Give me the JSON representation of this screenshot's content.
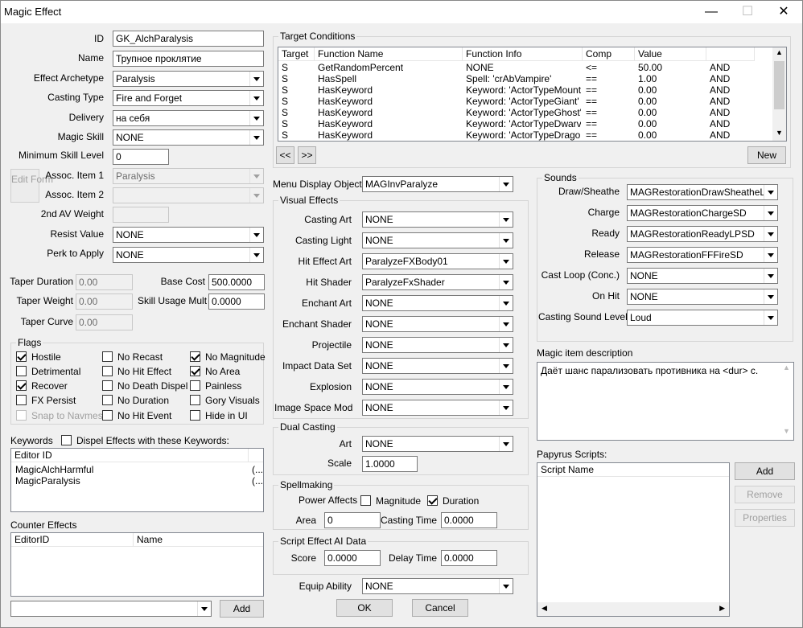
{
  "window": {
    "title": "Magic Effect",
    "minimize": "—",
    "maximize": "☐",
    "close": "✕"
  },
  "left": {
    "id_label": "ID",
    "id_value": "GK_AlchParalysis",
    "name_label": "Name",
    "name_value": "Трупное проклятие",
    "archetype_label": "Effect Archetype",
    "archetype_value": "Paralysis",
    "casting_type_label": "Casting Type",
    "casting_type_value": "Fire and Forget",
    "delivery_label": "Delivery",
    "delivery_value": "на себя",
    "magic_skill_label": "Magic Skill",
    "magic_skill_value": "NONE",
    "min_skill_label": "Minimum Skill Level",
    "min_skill_value": "0",
    "edit_form_label": "Edit Form",
    "assoc1_label": "Assoc. Item 1",
    "assoc1_value": "Paralysis",
    "assoc2_label": "Assoc. Item 2",
    "assoc2_value": "",
    "av2_label": "2nd AV Weight",
    "av2_value": "",
    "resist_label": "Resist Value",
    "resist_value": "NONE",
    "perk_label": "Perk to Apply",
    "perk_value": "NONE",
    "taper_duration_label": "Taper Duration",
    "taper_duration_value": "0.00",
    "taper_weight_label": "Taper Weight",
    "taper_weight_value": "0.00",
    "taper_curve_label": "Taper Curve",
    "taper_curve_value": "0.00",
    "base_cost_label": "Base Cost",
    "base_cost_value": "500.0000",
    "skill_mult_label": "Skill Usage Mult",
    "skill_mult_value": "0.0000"
  },
  "flags": {
    "title": "Flags",
    "items": [
      {
        "label": "Hostile",
        "checked": true,
        "disabled": false
      },
      {
        "label": "No Recast",
        "checked": false,
        "disabled": false
      },
      {
        "label": "No Magnitude",
        "checked": true,
        "disabled": false
      },
      {
        "label": "Detrimental",
        "checked": false,
        "disabled": false
      },
      {
        "label": "No Hit Effect",
        "checked": false,
        "disabled": false
      },
      {
        "label": "No Area",
        "checked": true,
        "disabled": false
      },
      {
        "label": "Recover",
        "checked": true,
        "disabled": false
      },
      {
        "label": "No Death Dispel",
        "checked": false,
        "disabled": false
      },
      {
        "label": "Painless",
        "checked": false,
        "disabled": false
      },
      {
        "label": "FX Persist",
        "checked": false,
        "disabled": false
      },
      {
        "label": "No Duration",
        "checked": false,
        "disabled": false
      },
      {
        "label": "Gory Visuals",
        "checked": false,
        "disabled": false
      },
      {
        "label": "Snap to Navmesh",
        "checked": false,
        "disabled": true
      },
      {
        "label": "No Hit Event",
        "checked": false,
        "disabled": false
      },
      {
        "label": "Hide in UI",
        "checked": false,
        "disabled": false
      }
    ]
  },
  "keywords": {
    "title": "Keywords",
    "dispel_label": "Dispel Effects with these Keywords:",
    "header_id": "Editor ID",
    "rows": [
      {
        "id": "MagicAlchHarmful",
        "extra": "(..."
      },
      {
        "id": "MagicParalysis",
        "extra": "(..."
      }
    ]
  },
  "counter": {
    "title": "Counter Effects",
    "header_id": "EditorID",
    "header_name": "Name",
    "add_label": "Add"
  },
  "target_conditions": {
    "title": "Target Conditions",
    "headers": [
      "Target",
      "Function Name",
      "Function Info",
      "Comp",
      "Value",
      ""
    ],
    "rows": [
      [
        "S",
        "GetRandomPercent",
        "NONE",
        "<=",
        "50.00",
        "AND"
      ],
      [
        "S",
        "HasSpell",
        "Spell: 'crAbVampire'",
        "==",
        "1.00",
        "AND"
      ],
      [
        "S",
        "HasKeyword",
        "Keyword: 'ActorTypeMount'",
        "==",
        "0.00",
        "AND"
      ],
      [
        "S",
        "HasKeyword",
        "Keyword: 'ActorTypeGiant'",
        "==",
        "0.00",
        "AND"
      ],
      [
        "S",
        "HasKeyword",
        "Keyword: 'ActorTypeGhost'",
        "==",
        "0.00",
        "AND"
      ],
      [
        "S",
        "HasKeyword",
        "Keyword: 'ActorTypeDwarv...",
        "==",
        "0.00",
        "AND"
      ],
      [
        "S",
        "HasKeyword",
        "Keyword: 'ActorTypeDragon'",
        "==",
        "0.00",
        "AND"
      ]
    ],
    "prev_label": "<<",
    "next_label": ">>",
    "new_label": "New"
  },
  "menu_display": {
    "label": "Menu Display Object",
    "value": "MAGInvParalyze"
  },
  "visual": {
    "title": "Visual Effects",
    "items": [
      {
        "label": "Casting Art",
        "value": "NONE"
      },
      {
        "label": "Casting Light",
        "value": "NONE"
      },
      {
        "label": "Hit Effect Art",
        "value": "ParalyzeFXBody01"
      },
      {
        "label": "Hit Shader",
        "value": "ParalyzeFxShader"
      },
      {
        "label": "Enchant Art",
        "value": "NONE"
      },
      {
        "label": "Enchant Shader",
        "value": "NONE"
      },
      {
        "label": "Projectile",
        "value": "NONE"
      },
      {
        "label": "Impact Data Set",
        "value": "NONE"
      },
      {
        "label": "Explosion",
        "value": "NONE"
      },
      {
        "label": "Image Space Mod",
        "value": "NONE"
      }
    ]
  },
  "dual": {
    "title": "Dual Casting",
    "art_label": "Art",
    "art_value": "NONE",
    "scale_label": "Scale",
    "scale_value": "1.0000"
  },
  "spellmaking": {
    "title": "Spellmaking",
    "power_label": "Power Affects",
    "magnitude_label": "Magnitude",
    "magnitude_checked": false,
    "duration_label": "Duration",
    "duration_checked": true,
    "area_label": "Area",
    "area_value": "0",
    "casting_time_label": "Casting Time",
    "casting_time_value": "0.0000"
  },
  "script_ai": {
    "title": "Script Effect AI Data",
    "score_label": "Score",
    "score_value": "0.0000",
    "delay_label": "Delay Time",
    "delay_value": "0.0000"
  },
  "equip": {
    "label": "Equip Ability",
    "value": "NONE"
  },
  "buttons": {
    "ok": "OK",
    "cancel": "Cancel"
  },
  "sounds": {
    "title": "Sounds",
    "items": [
      {
        "label": "Draw/Sheathe",
        "value": "MAGRestorationDrawSheatheLPMSD"
      },
      {
        "label": "Charge",
        "value": "MAGRestorationChargeSD"
      },
      {
        "label": "Ready",
        "value": "MAGRestorationReadyLPSD"
      },
      {
        "label": "Release",
        "value": "MAGRestorationFFFireSD"
      },
      {
        "label": "Cast Loop (Conc.)",
        "value": "NONE"
      },
      {
        "label": "On Hit",
        "value": "NONE"
      },
      {
        "label": "Casting Sound Level",
        "value": "Loud"
      }
    ]
  },
  "description": {
    "label": "Magic item description",
    "value": "Даёт шанс парализовать противника на <dur> с."
  },
  "papyrus": {
    "label": "Papyrus Scripts:",
    "header": "Script Name",
    "add": "Add",
    "remove": "Remove",
    "properties": "Properties"
  }
}
